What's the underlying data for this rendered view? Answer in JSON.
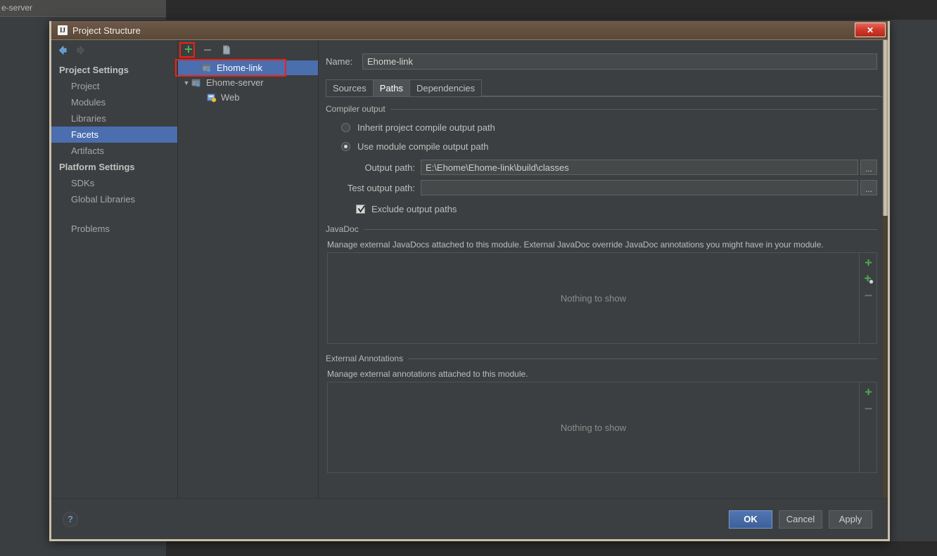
{
  "background": {
    "window_label": "e-server"
  },
  "window": {
    "title": "Project Structure",
    "app_icon": "IJ",
    "app_icon_name": "intellij-idea-icon",
    "close_label": "✕"
  },
  "nav": {
    "back_icon": "back-arrow-icon",
    "forward_icon": "forward-arrow-icon"
  },
  "sidebar": {
    "groups": [
      {
        "label": "Project Settings",
        "items": [
          {
            "label": "Project",
            "selected": false
          },
          {
            "label": "Modules",
            "selected": false
          },
          {
            "label": "Libraries",
            "selected": false
          },
          {
            "label": "Facets",
            "selected": true
          },
          {
            "label": "Artifacts",
            "selected": false
          }
        ]
      },
      {
        "label": "Platform Settings",
        "items": [
          {
            "label": "SDKs",
            "selected": false
          },
          {
            "label": "Global Libraries",
            "selected": false
          }
        ]
      }
    ],
    "extra": [
      {
        "label": "Problems",
        "selected": false
      }
    ]
  },
  "tree_toolbar": {
    "add_label": "+",
    "remove_label": "−",
    "copy_icon": "copy-icon"
  },
  "tree": {
    "items": [
      {
        "label": "Ehome-link",
        "indent": 1,
        "toggle": "",
        "icon": "module-icon",
        "selected": true
      },
      {
        "label": "Ehome-server",
        "indent": 0,
        "toggle": "▼",
        "icon": "module-icon",
        "selected": false
      },
      {
        "label": "Web",
        "indent": 2,
        "toggle": "",
        "icon": "web-facet-icon",
        "selected": false
      }
    ]
  },
  "main": {
    "name_label": "Name:",
    "name_value": "Ehome-link",
    "name_placeholder": "",
    "tabs": [
      {
        "label": "Sources",
        "active": false
      },
      {
        "label": "Paths",
        "active": true
      },
      {
        "label": "Dependencies",
        "active": false
      }
    ],
    "compiler_output": {
      "title": "Compiler output",
      "options": [
        {
          "label": "Inherit project compile output path",
          "selected": false
        },
        {
          "label": "Use module compile output path",
          "selected": true
        }
      ],
      "output_path_label": "Output path:",
      "output_path_value": "E:\\Ehome\\Ehome-link\\build\\classes",
      "test_output_path_label": "Test output path:",
      "test_output_path_value": "",
      "browse_label": "...",
      "exclude_label": "Exclude output paths",
      "exclude_checked": true
    },
    "javadoc": {
      "title": "JavaDoc",
      "description": "Manage external JavaDocs attached to this module. External JavaDoc override JavaDoc annotations you might have in your module.",
      "empty_text": "Nothing to show",
      "actions": [
        {
          "icon": "add-icon",
          "label": "+"
        },
        {
          "icon": "add-url-icon",
          "label": "+"
        },
        {
          "icon": "remove-icon",
          "label": "−"
        }
      ]
    },
    "external_annotations": {
      "title": "External Annotations",
      "description": "Manage external annotations attached to this module.",
      "empty_text": "Nothing to show",
      "actions": [
        {
          "icon": "add-icon",
          "label": "+"
        },
        {
          "icon": "remove-icon",
          "label": "−"
        }
      ]
    }
  },
  "footer": {
    "help_label": "?",
    "buttons": [
      {
        "label": "OK",
        "primary": true,
        "mnemonic": "O"
      },
      {
        "label": "Cancel",
        "primary": false,
        "mnemonic": ""
      },
      {
        "label": "Apply",
        "primary": false,
        "mnemonic": "A"
      }
    ]
  },
  "colors": {
    "accent_selection": "#4b6eaf",
    "window_border": "#cbbfa8",
    "titlebar": "#5b4938",
    "panel_bg": "#3c3f41",
    "annotation": "#f02112",
    "add_green": "#4caf50",
    "close_red": "#cf3a2b"
  }
}
